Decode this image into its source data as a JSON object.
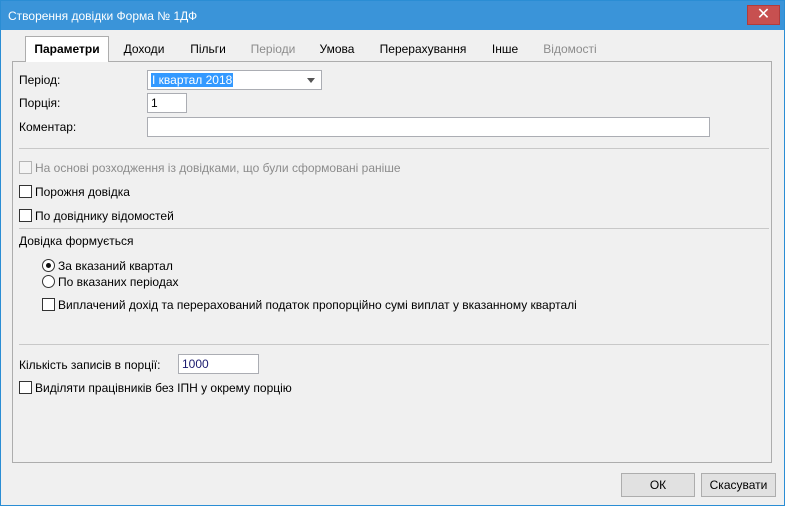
{
  "window": {
    "title": "Створення довідки Форма № 1ДФ",
    "close_glyph": "✕"
  },
  "tabs": [
    {
      "label": "Параметри",
      "state": "active"
    },
    {
      "label": "Доходи",
      "state": "normal"
    },
    {
      "label": "Пільги",
      "state": "normal"
    },
    {
      "label": "Періоди",
      "state": "disabled"
    },
    {
      "label": "Умова",
      "state": "normal"
    },
    {
      "label": "Перерахування",
      "state": "normal"
    },
    {
      "label": "Інше",
      "state": "normal"
    },
    {
      "label": "Відомості",
      "state": "disabled"
    }
  ],
  "params": {
    "period_label": "Період:",
    "period_value": "I  квартал 2018",
    "portion_label": "Порція:",
    "portion_value": "1",
    "comment_label": "Коментар:",
    "comment_value": ""
  },
  "options": {
    "based_on_diff": {
      "label": "На основі розходження із довідками, що були сформовані раніше",
      "checked": false,
      "disabled": true
    },
    "empty_certificate": {
      "label": "Порожня довідка",
      "checked": false
    },
    "by_statements_ref": {
      "label": "По довіднику відомостей",
      "checked": false
    }
  },
  "formation": {
    "group_label": "Довідка формується",
    "radio_quarter": {
      "label": "За вказаний квартал",
      "selected": true
    },
    "radio_periods": {
      "label": "По вказаних періодах",
      "selected": false
    },
    "proportional": {
      "label": "Виплачений дохід та перерахований податок пропорційно сумі виплат у вказанному кварталі",
      "checked": false
    }
  },
  "records": {
    "count_label": "Кількість записів в порції:",
    "count_value": "1000",
    "separate_no_ipn": {
      "label": "Виділяти працівників без ІПН у окрему порцію",
      "checked": false
    }
  },
  "buttons": {
    "ok": "ОК",
    "cancel": "Скасувати"
  },
  "colors": {
    "titlebar": "#3a94d9",
    "close": "#c75050",
    "selection": "#3399ff"
  }
}
